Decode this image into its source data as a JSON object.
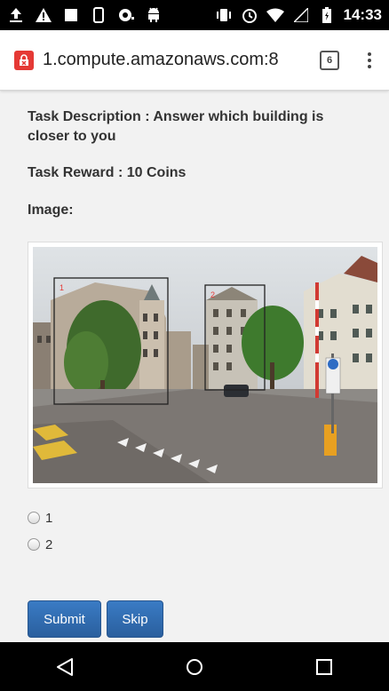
{
  "status_bar": {
    "time": "14:33",
    "icons": [
      "upload-icon",
      "alert-icon",
      "image-icon",
      "phone-icon",
      "voicemail-icon",
      "android-icon",
      "vibrate-icon",
      "alarm-icon",
      "wifi-icon",
      "signal-icon",
      "battery-icon"
    ]
  },
  "browser": {
    "url": "1.compute.amazonaws.com:8",
    "tab_count": "6"
  },
  "task": {
    "description": "Task Description : Answer which building is closer to you",
    "reward": "Task Reward : 10 Coins",
    "image_label": "Image:",
    "box_labels": [
      "1",
      "2"
    ]
  },
  "options": [
    {
      "label": "1"
    },
    {
      "label": "2"
    }
  ],
  "buttons": {
    "submit": "Submit",
    "skip": "Skip"
  },
  "colors": {
    "button": "#2f6aad",
    "box_label": "#e53935"
  }
}
